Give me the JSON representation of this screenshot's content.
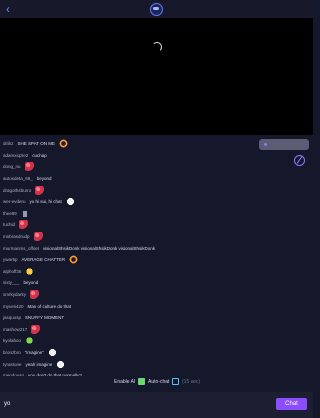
{
  "header": {
    "back_icon": "chevron-left-icon",
    "logo_icon": "app-logo-icon"
  },
  "player": {
    "state": "loading"
  },
  "chat": {
    "messages": [
      {
        "user": "dirikz",
        "text": "SHE SPAT ON ME",
        "emote": "red-ring"
      },
      {
        "user": "adamxiqzle2",
        "text": "cuchap",
        "emote": ""
      },
      {
        "user": "dong_nu",
        "text": "",
        "emote": "red"
      },
      {
        "user": "autosdeta_69_",
        "text": "beyond",
        "emote": ""
      },
      {
        "user": "dragoth4burro",
        "text": "",
        "emote": "red"
      },
      {
        "user": "wer-evderu",
        "text": "yo hi sui, hi chat",
        "emote": "white"
      },
      {
        "user": "thee89",
        "text": "",
        "emote": "cup"
      },
      {
        "user": "tuchid",
        "text": "",
        "emote": "red"
      },
      {
        "user": "mnbrasdrudp",
        "text": "",
        "emote": "red"
      },
      {
        "user": "murmanms_offset",
        "text": "visionalShsikDonk visionalShsikDonk visionalShsikDonk",
        "emote": ""
      },
      {
        "user": "ywar5p",
        "text": "AVERAGE CHATTER",
        "emote": "red-ring"
      },
      {
        "user": "alphoff36",
        "text": "",
        "emote": "gold"
      },
      {
        "user": "sixty___",
        "text": "beyond",
        "emote": ""
      },
      {
        "user": "smrkydarky",
        "text": "",
        "emote": "red"
      },
      {
        "user": "myves420",
        "text": "Man of culture do that",
        "emote": ""
      },
      {
        "user": "jasquosp",
        "text": "SNUFFY MOMENT",
        "emote": ""
      },
      {
        "user": "mashow217",
        "text": "",
        "emote": "red"
      },
      {
        "user": "kyolaboo",
        "text": "",
        "emote": "green"
      },
      {
        "user": "bronzbro",
        "text": "\"imagine\"",
        "emote": "white"
      },
      {
        "user": "tyrastone",
        "text": "yeah imagine",
        "emote": "white"
      },
      {
        "user": "mendoyan",
        "text": "you don't do that normally?",
        "emote": ""
      }
    ]
  },
  "side": {
    "pill_label": "",
    "pill_icon": "purple-dot-icon",
    "action_icon": "slash-circle-icon"
  },
  "controls": {
    "enable_ai_label": "Enable AI",
    "enable_ai_checked": true,
    "auto_chat_label": "Auto-chat",
    "auto_chat_checked": false,
    "auto_chat_suffix": "(15 sec)"
  },
  "composer": {
    "value": "yo",
    "send_label": "Chat"
  }
}
